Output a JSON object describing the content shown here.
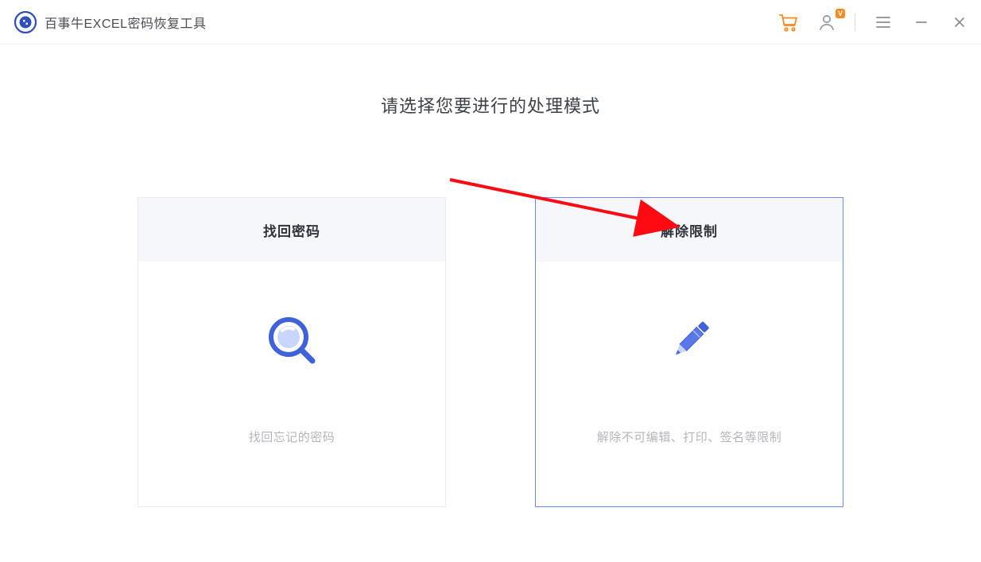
{
  "app": {
    "title": "百事牛EXCEL密码恢复工具"
  },
  "titlebar": {
    "cart_icon": "cart-icon",
    "user_icon": "user-icon",
    "vip_badge": "V",
    "menu_icon": "hamburger-icon",
    "minimize_icon": "minimize-icon",
    "close_icon": "close-icon"
  },
  "main": {
    "heading": "请选择您要进行的处理模式",
    "cards": [
      {
        "title": "找回密码",
        "desc": "找回忘记的密码",
        "icon": "search-icon",
        "selected": false
      },
      {
        "title": "解除限制",
        "desc": "解除不可编辑、打印、签名等限制",
        "icon": "pencil-icon",
        "selected": true
      }
    ]
  },
  "colors": {
    "accent": "#3f61d9",
    "accent_light": "#6e8cf5",
    "orange": "#ff8a1e",
    "text": "#3d4148",
    "muted": "#b3b7bd",
    "panel_bg": "#f5f7fb",
    "arrow": "#ff0a12"
  }
}
